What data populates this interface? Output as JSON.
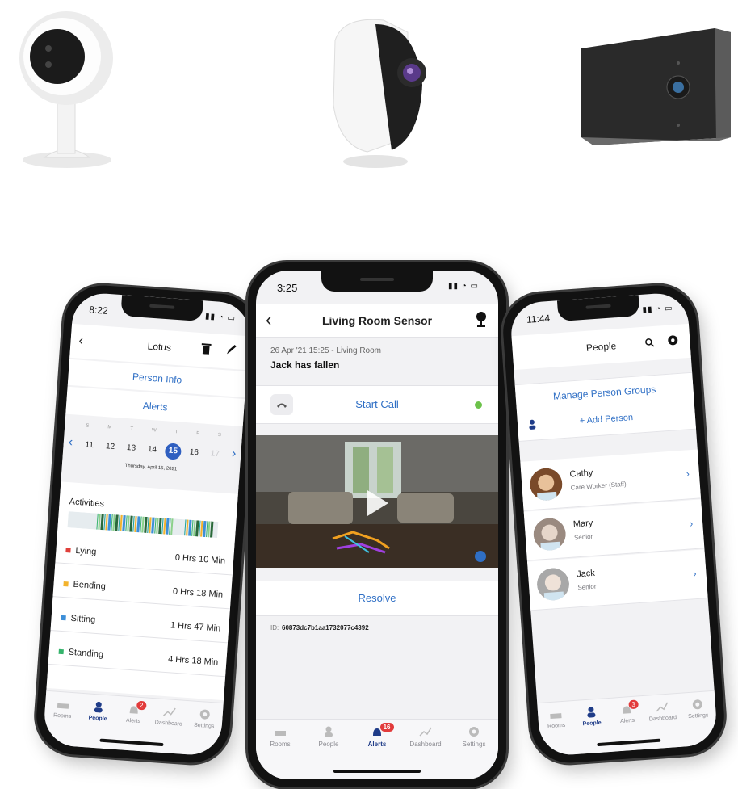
{
  "left_phone": {
    "time": "8:22",
    "title": "Lotus",
    "person_info": "Person Info",
    "alerts": "Alerts",
    "weekdays": [
      "S",
      "M",
      "T",
      "W",
      "T",
      "F",
      "S"
    ],
    "dates": [
      "11",
      "12",
      "13",
      "14",
      "15",
      "16",
      "17"
    ],
    "selected_date": "15",
    "date_caption": "Thursday, April 15, 2021",
    "activities_label": "Activities",
    "activities": [
      {
        "label": "Lying",
        "value": "0 Hrs 10 Min",
        "color": "#e0403b"
      },
      {
        "label": "Bending",
        "value": "0 Hrs 18 Min",
        "color": "#f3b32d"
      },
      {
        "label": "Sitting",
        "value": "1 Hrs 47 Min",
        "color": "#3d8fd8"
      },
      {
        "label": "Standing",
        "value": "4 Hrs 18 Min",
        "color": "#34b36b"
      }
    ],
    "tabs": {
      "rooms": "Rooms",
      "people": "People",
      "alerts": "Alerts",
      "dashboard": "Dashboard",
      "settings": "Settings",
      "alerts_badge": "2"
    }
  },
  "mid_phone": {
    "time": "3:25",
    "title": "Living Room Sensor",
    "alert_meta": "26 Apr '21 15:25 - Living Room",
    "alert_text": "Jack has fallen",
    "start_call": "Start Call",
    "resolve": "Resolve",
    "id_label": "ID:",
    "id_value": "60873dc7b1aa1732077c4392",
    "tabs": {
      "rooms": "Rooms",
      "people": "People",
      "alerts": "Alerts",
      "dashboard": "Dashboard",
      "settings": "Settings",
      "alerts_badge": "16"
    }
  },
  "right_phone": {
    "time": "11:44",
    "title": "People",
    "manage_groups": "Manage Person Groups",
    "add_person": "+ Add Person",
    "people": [
      {
        "name": "Cathy",
        "role": "Care Worker (Staff)"
      },
      {
        "name": "Mary",
        "role": "Senior"
      },
      {
        "name": "Jack",
        "role": "Senior"
      }
    ],
    "tabs": {
      "rooms": "Rooms",
      "people": "People",
      "alerts": "Alerts",
      "dashboard": "Dashboard",
      "settings": "Settings",
      "alerts_badge": "3"
    }
  },
  "colors": {
    "accent": "#2f6fc5",
    "navy": "#1f3c88",
    "badge": "#e23b3b",
    "online": "#6cc24a"
  }
}
